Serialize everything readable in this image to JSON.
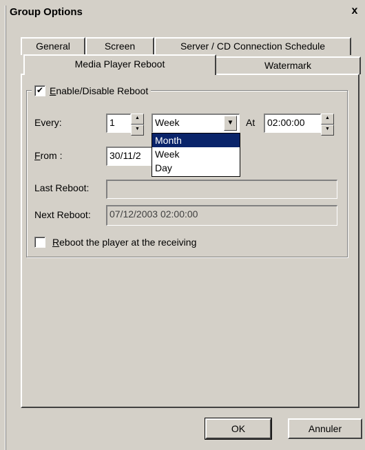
{
  "window": {
    "title": "Group Options",
    "close_label": "x"
  },
  "tabs": {
    "row1": [
      "General",
      "Screen",
      "Server / CD Connection Schedule"
    ],
    "row2_active": "Media Player Reboot",
    "row2_other": "Watermark"
  },
  "reboot": {
    "group_label_ul": "E",
    "group_label_rest": "nable/Disable Reboot",
    "enabled": true,
    "every_label": "Every:",
    "every_value": "1",
    "period_value": "Week",
    "period_options": [
      "Month",
      "Week",
      "Day"
    ],
    "selected_option": "Month",
    "at_label": "At",
    "at_value": "02:00:00",
    "from_label_ul": "F",
    "from_label_rest": "rom :",
    "from_value": "30/11/2",
    "last_reboot_label": "Last Reboot:",
    "last_reboot_value": "",
    "next_reboot_label": "Next Reboot:",
    "next_reboot_value": "07/12/2003 02:00:00",
    "receive_ul": "R",
    "receive_rest": "eboot the player at the receiving",
    "receive_checked": false
  },
  "buttons": {
    "ok": "OK",
    "cancel": "Annuler"
  },
  "icons": {
    "checkmark": "✔",
    "up": "▲",
    "down": "▼",
    "drop": "▼"
  },
  "colors": {
    "face": "#d4d0c8",
    "selection": "#0a246a"
  }
}
